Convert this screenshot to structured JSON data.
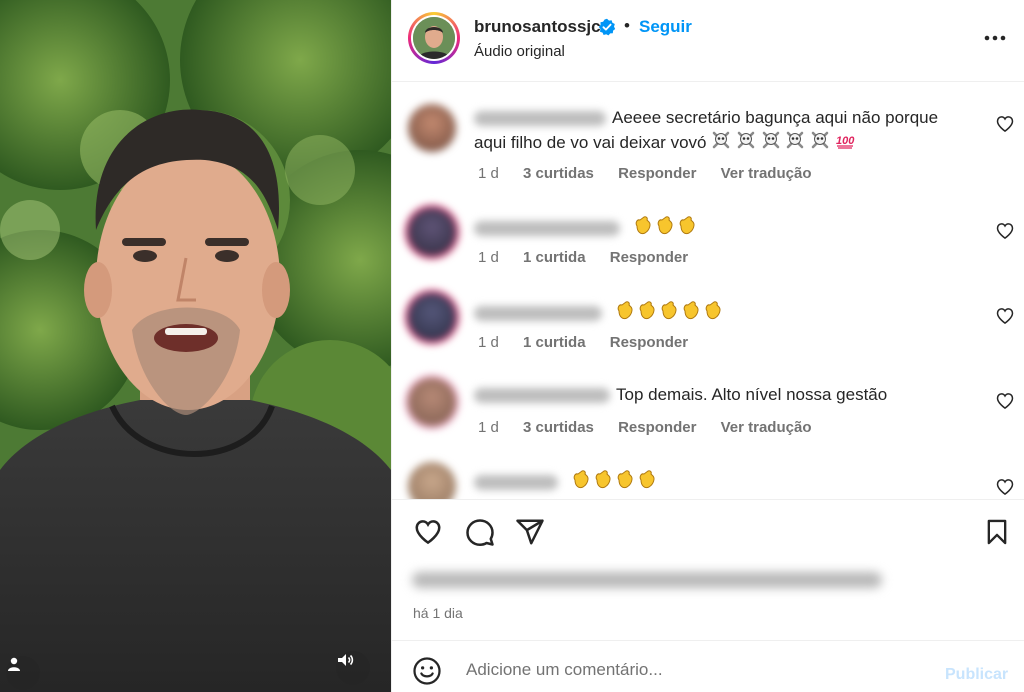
{
  "post": {
    "username": "brunosantossjc",
    "follow_label": "Seguir",
    "separator": "•",
    "audio": "Áudio original",
    "time_ago": "há 1 dia"
  },
  "comments": [
    {
      "text": "Aeeee secretário bagunça aqui não porque aqui filho de vo vai deixar vovó",
      "emojis": [
        "skull-crossbones",
        "skull-crossbones",
        "skull-crossbones",
        "skull-crossbones",
        "skull-crossbones",
        "hundred"
      ],
      "age": "1 d",
      "likes": "3 curtidas",
      "reply": "Responder",
      "translate": "Ver tradução"
    },
    {
      "text": "",
      "emojis": [
        "clap",
        "clap",
        "clap"
      ],
      "age": "1 d",
      "likes": "1 curtida",
      "reply": "Responder"
    },
    {
      "text": "",
      "emojis": [
        "clap",
        "clap",
        "clap",
        "clap",
        "clap"
      ],
      "age": "1 d",
      "likes": "1 curtida",
      "reply": "Responder"
    },
    {
      "text": "Top demais. Alto nível nossa gestão",
      "emojis": [],
      "age": "1 d",
      "likes": "3 curtidas",
      "reply": "Responder",
      "translate": "Ver tradução"
    },
    {
      "text": "",
      "emojis": [
        "clap",
        "clap",
        "clap",
        "clap"
      ]
    }
  ],
  "add_comment": {
    "placeholder": "Adicione um comentário...",
    "publish": "Publicar"
  },
  "icons": {
    "verified": "verified-badge-icon",
    "more": "more-options-icon",
    "like": "heart-icon",
    "comment": "comment-icon",
    "share": "share-icon",
    "save": "bookmark-icon",
    "emoji": "emoji-icon",
    "user_tag": "user-icon",
    "audio": "speaker-icon"
  },
  "colors": {
    "accent": "#0095f6",
    "publish_disabled": "#c8e4fd",
    "text": "#262626",
    "muted": "#737373"
  }
}
